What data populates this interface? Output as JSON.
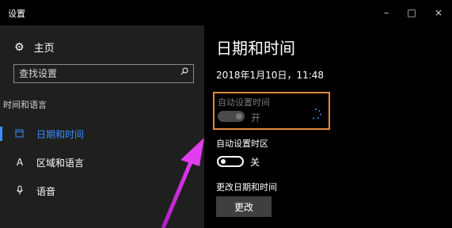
{
  "window": {
    "title": "设置",
    "controls": {
      "minimize": "–",
      "maximize": "□",
      "close": "×"
    }
  },
  "sidebar": {
    "home": {
      "icon": "gear-icon",
      "label": "主页"
    },
    "search": {
      "placeholder": "查找设置",
      "icon": "search-icon"
    },
    "section_title": "时间和语言",
    "items": [
      {
        "label": "日期和时间",
        "icon": "calendar-clock-icon",
        "active": true
      },
      {
        "label": "区域和语言",
        "icon": "region-language-icon",
        "active": false
      },
      {
        "label": "语音",
        "icon": "microphone-icon",
        "active": false
      }
    ]
  },
  "main": {
    "title": "日期和时间",
    "current_datetime": "2018年1月10日，11:48",
    "auto_time": {
      "label": "自动设置时间",
      "state": "开",
      "disabled": true
    },
    "auto_timezone": {
      "label": "自动设置时区",
      "state": "关"
    },
    "change_datetime": {
      "label": "更改日期和时间",
      "button": "更改"
    }
  },
  "colors": {
    "accent": "#3b8cff",
    "highlight_box": "#e08a3c",
    "annotation_arrow": "#e23cf0",
    "sidebar_bg": "#1f1f1f",
    "main_bg": "#000000"
  }
}
